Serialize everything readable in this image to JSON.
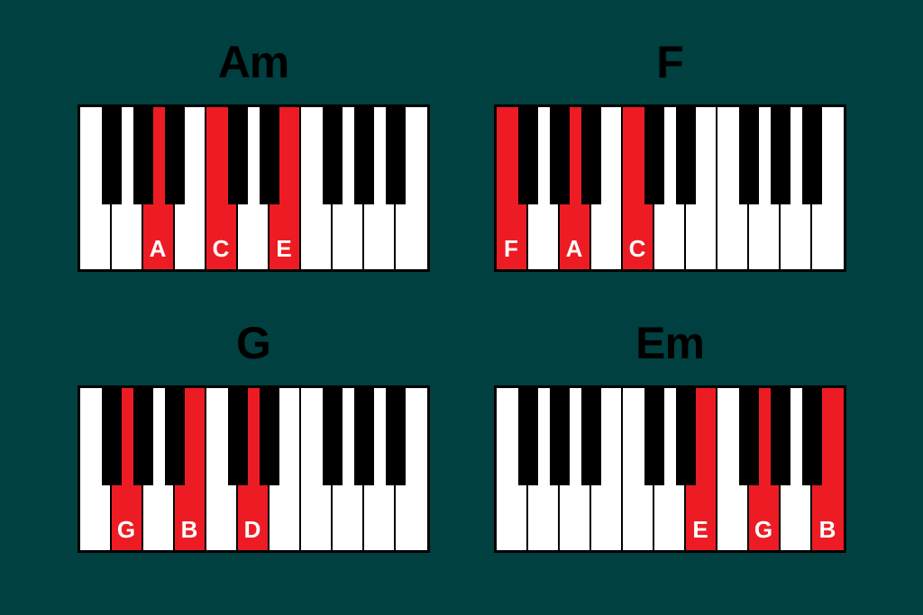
{
  "colors": {
    "background": "#004040",
    "highlight": "#ed1c24",
    "black": "#000000",
    "white": "#ffffff"
  },
  "chords": [
    {
      "name": "Am",
      "start_note": "F",
      "white_keys": 11,
      "highlighted": [
        {
          "index": 2,
          "label": "A"
        },
        {
          "index": 4,
          "label": "C"
        },
        {
          "index": 6,
          "label": "E"
        }
      ]
    },
    {
      "name": "F",
      "start_note": "F",
      "white_keys": 11,
      "highlighted": [
        {
          "index": 0,
          "label": "F"
        },
        {
          "index": 2,
          "label": "A"
        },
        {
          "index": 4,
          "label": "C"
        }
      ]
    },
    {
      "name": "G",
      "start_note": "F",
      "white_keys": 11,
      "highlighted": [
        {
          "index": 1,
          "label": "G"
        },
        {
          "index": 3,
          "label": "B"
        },
        {
          "index": 5,
          "label": "D"
        }
      ]
    },
    {
      "name": "Em",
      "start_note": "F",
      "white_keys": 11,
      "highlighted": [
        {
          "index": 6,
          "label": "E"
        },
        {
          "index": 8,
          "label": "G"
        },
        {
          "index": 10,
          "label": "B"
        }
      ]
    }
  ]
}
